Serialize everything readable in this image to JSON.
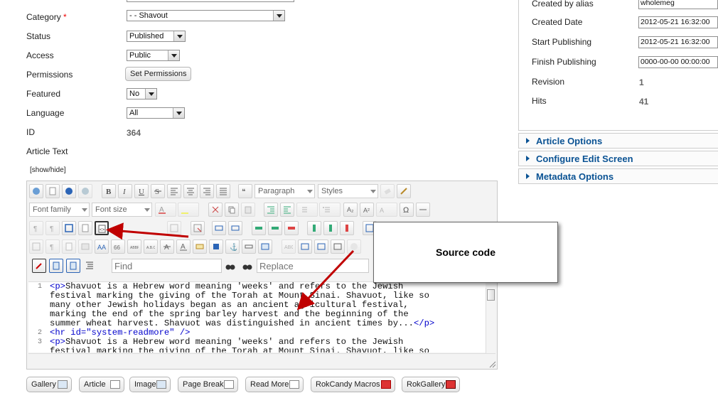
{
  "form": {
    "category_label": "Category",
    "required_mark": "*",
    "category_value": "- - Shavout",
    "status_label": "Status",
    "status_value": "Published",
    "access_label": "Access",
    "access_value": "Public",
    "permissions_label": "Permissions",
    "permissions_button": "Set Permissions",
    "featured_label": "Featured",
    "featured_value": "No",
    "language_label": "Language",
    "language_value": "All",
    "id_label": "ID",
    "id_value": "364",
    "article_text_label": "Article Text",
    "show_hide": "[show/hide]"
  },
  "editor": {
    "format_select": "Paragraph",
    "styles_select": "Styles",
    "font_family_select": "Font family",
    "font_size_select": "Font size",
    "find_placeholder": "Find",
    "replace_placeholder": "Replace",
    "code_lines": [
      {
        "num": "1",
        "parts": [
          "<p>",
          "Shavuot is a Hebrew word meaning 'weeks' and refers to the Jewish"
        ]
      },
      {
        "num": "",
        "parts": [
          "",
          "festival marking the giving of the Torah at Mount Sinai. Shavuot, like so"
        ]
      },
      {
        "num": "",
        "parts": [
          "",
          "many other Jewish holidays began as an ancient agricultural festival,"
        ]
      },
      {
        "num": "",
        "parts": [
          "",
          "marking the end of the spring barley harvest and the beginning of the"
        ]
      },
      {
        "num": "",
        "parts": [
          "",
          "summer wheat harvest. Shavuot was distinguished in ancient times by..."
        ]
      },
      {
        "num": "2",
        "parts": [
          "<hr id=\"system-readmore\" />",
          ""
        ]
      },
      {
        "num": "3",
        "parts": [
          "<p>",
          "Shavuot is a Hebrew word meaning 'weeks' and refers to the Jewish"
        ]
      },
      {
        "num": "",
        "parts": [
          "",
          "festival marking the giving of the Torah at Mount Sinai. Shavuot, like so"
        ]
      }
    ],
    "line1_end": "</p>",
    "callout_text": "Source code"
  },
  "buttons": {
    "gallery": "Gallery",
    "article": "Article",
    "image": "Image",
    "page_break": "Page Break",
    "read_more": "Read More",
    "rokcandy": "RokCandy Macros",
    "rokgallery": "RokGallery"
  },
  "right": {
    "created_by_alias_label": "Created by alias",
    "created_by_alias_value": "wholemeg",
    "created_date_label": "Created Date",
    "created_date_value": "2012-05-21 16:32:00",
    "start_publishing_label": "Start Publishing",
    "start_publishing_value": "2012-05-21 16:32:00",
    "finish_publishing_label": "Finish Publishing",
    "finish_publishing_value": "0000-00-00 00:00:00",
    "revision_label": "Revision",
    "revision_value": "1",
    "hits_label": "Hits",
    "hits_value": "41",
    "article_options": "Article Options",
    "configure_edit_screen": "Configure Edit Screen",
    "metadata_options": "Metadata Options"
  },
  "colors": {
    "accent_blue": "#0b5394",
    "arrow_red": "#c00000",
    "tag_blue": "#0000cc"
  }
}
